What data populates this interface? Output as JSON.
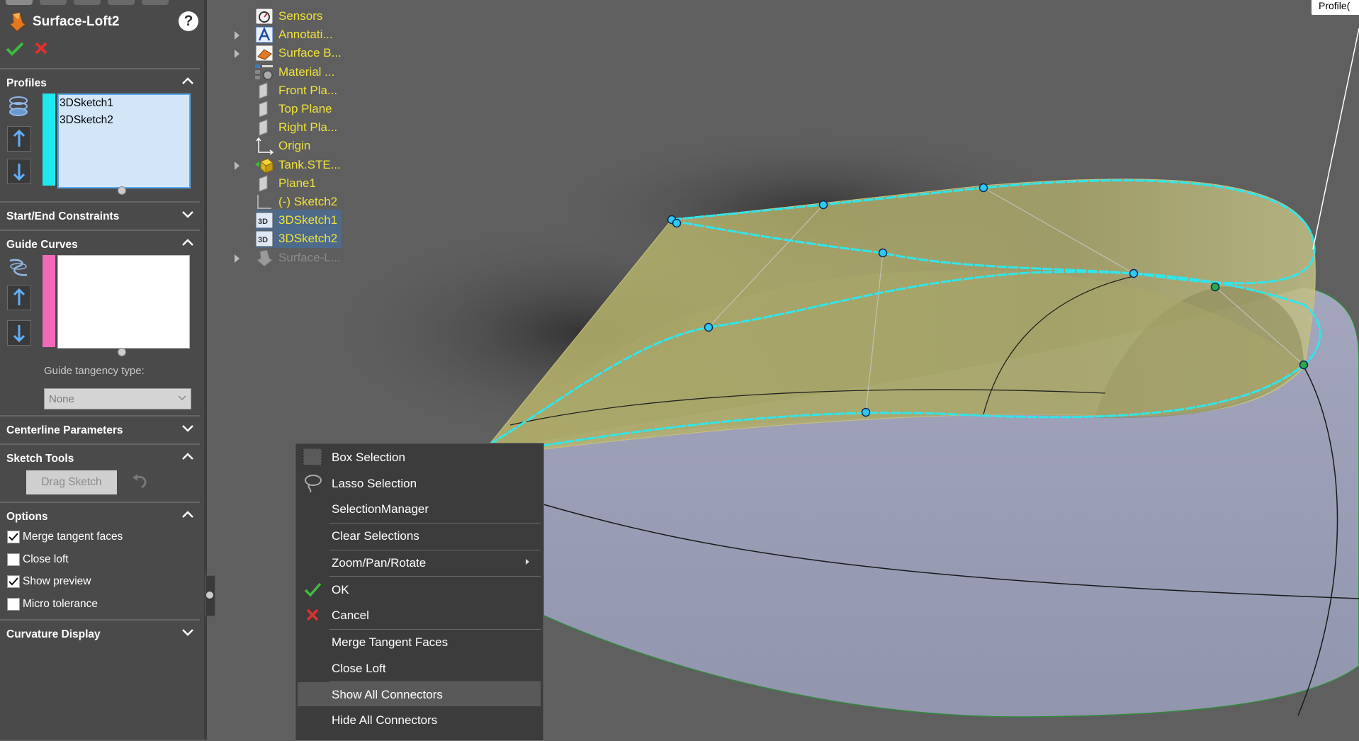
{
  "property_manager": {
    "title": "Surface-Loft2",
    "help": "?",
    "sections": {
      "profiles": "Profiles",
      "start_end": "Start/End Constraints",
      "guide_curves": "Guide Curves",
      "centerline": "Centerline Parameters",
      "sketch_tools": "Sketch Tools",
      "options": "Options",
      "curvature": "Curvature Display"
    },
    "profiles_list": [
      "3DSketch1",
      "3DSketch2"
    ],
    "guide_tangency_label": "Guide tangency type:",
    "guide_tangency_value": "None",
    "drag_sketch": "Drag Sketch",
    "options": [
      {
        "label": "Merge tangent faces",
        "checked": true
      },
      {
        "label": "Close loft",
        "checked": false
      },
      {
        "label": "Show preview",
        "checked": true
      },
      {
        "label": "Micro tolerance",
        "checked": false
      }
    ]
  },
  "feature_tree": [
    {
      "label": "Sensors",
      "icon": "sensors-icon",
      "expandable": false
    },
    {
      "label": "Annotati...",
      "icon": "annotations-icon",
      "expandable": true
    },
    {
      "label": "Surface B...",
      "icon": "surface-bodies-icon",
      "expandable": true
    },
    {
      "label": "Material ...",
      "icon": "material-icon",
      "expandable": false
    },
    {
      "label": "Front Pla...",
      "icon": "plane-icon",
      "expandable": false
    },
    {
      "label": "Top Plane",
      "icon": "plane-icon",
      "expandable": false
    },
    {
      "label": "Right Pla...",
      "icon": "plane-icon",
      "expandable": false
    },
    {
      "label": "Origin",
      "icon": "origin-icon",
      "expandable": false
    },
    {
      "label": "Tank.STE...",
      "icon": "imported-part-icon",
      "expandable": true
    },
    {
      "label": "Plane1",
      "icon": "plane-icon",
      "expandable": false
    },
    {
      "label": "(-) Sketch2",
      "icon": "sketch-icon",
      "expandable": false
    },
    {
      "label": "3DSketch1",
      "icon": "3dsketch-icon",
      "expandable": false,
      "selected": true
    },
    {
      "label": "3DSketch2",
      "icon": "3dsketch-icon",
      "expandable": false,
      "selected": true
    },
    {
      "label": "Surface-L...",
      "icon": "surface-loft-icon",
      "expandable": true,
      "greyed": true
    }
  ],
  "context_menu": {
    "items": [
      {
        "label": "Box Selection",
        "icon": "box-selection-icon"
      },
      {
        "label": "Lasso Selection",
        "icon": "lasso-selection-icon"
      },
      {
        "label": "SelectionManager",
        "icon": ""
      },
      {
        "label": "Clear Selections",
        "icon": ""
      },
      {
        "label": "Zoom/Pan/Rotate",
        "icon": "",
        "submenu": true
      },
      {
        "label": "OK",
        "icon": "check-icon"
      },
      {
        "label": "Cancel",
        "icon": "cross-icon"
      },
      {
        "label": "Merge Tangent Faces",
        "icon": ""
      },
      {
        "label": "Close Loft",
        "icon": ""
      },
      {
        "label": "Show All Connectors",
        "icon": "",
        "hover": true
      },
      {
        "label": "Hide All Connectors",
        "icon": ""
      }
    ]
  },
  "viewport": {
    "callout_label": "Profile(",
    "colors": {
      "background": "#5f5f5f",
      "body": "#9a9db5",
      "loft": "#b8b56a",
      "curve": "#2ee8ee",
      "tree_text": "#f0e13c"
    }
  }
}
